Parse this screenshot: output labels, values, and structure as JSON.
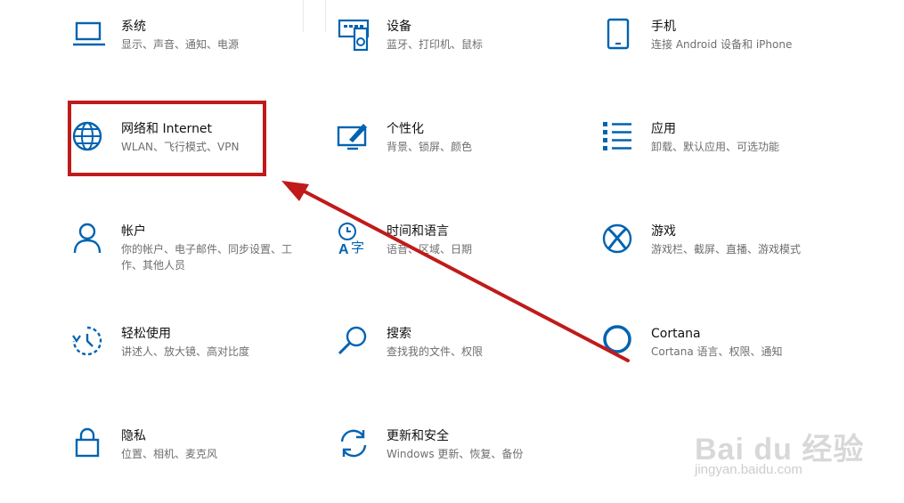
{
  "tiles": [
    {
      "title": "系统",
      "sub": "显示、声音、通知、电源",
      "icon": "laptop-icon"
    },
    {
      "title": "设备",
      "sub": "蓝牙、打印机、鼠标",
      "icon": "devices-icon"
    },
    {
      "title": "手机",
      "sub": "连接 Android 设备和 iPhone",
      "icon": "phone-icon"
    },
    {
      "title": "网络和 Internet",
      "sub": "WLAN、飞行模式、VPN",
      "icon": "globe-icon"
    },
    {
      "title": "个性化",
      "sub": "背景、锁屏、颜色",
      "icon": "paint-icon"
    },
    {
      "title": "应用",
      "sub": "卸载、默认应用、可选功能",
      "icon": "apps-list-icon"
    },
    {
      "title": "帐户",
      "sub": "你的帐户、电子邮件、同步设置、工作、其他人员",
      "icon": "person-icon"
    },
    {
      "title": "时间和语言",
      "sub": "语音、区域、日期",
      "icon": "time-language-icon"
    },
    {
      "title": "游戏",
      "sub": "游戏栏、截屏、直播、游戏模式",
      "icon": "xbox-icon"
    },
    {
      "title": "轻松使用",
      "sub": "讲述人、放大镜、高对比度",
      "icon": "ease-of-access-icon"
    },
    {
      "title": "搜索",
      "sub": "查找我的文件、权限",
      "icon": "search-icon"
    },
    {
      "title": "Cortana",
      "sub": "Cortana 语言、权限、通知",
      "icon": "cortana-icon"
    },
    {
      "title": "隐私",
      "sub": "位置、相机、麦克风",
      "icon": "lock-icon"
    },
    {
      "title": "更新和安全",
      "sub": "Windows 更新、恢复、备份",
      "icon": "sync-icon"
    }
  ],
  "watermark": {
    "brand": "Bai du 经验",
    "url": "jingyan.baidu.com"
  },
  "colors": {
    "accent": "#0063b1",
    "highlight": "#c01a1a"
  }
}
